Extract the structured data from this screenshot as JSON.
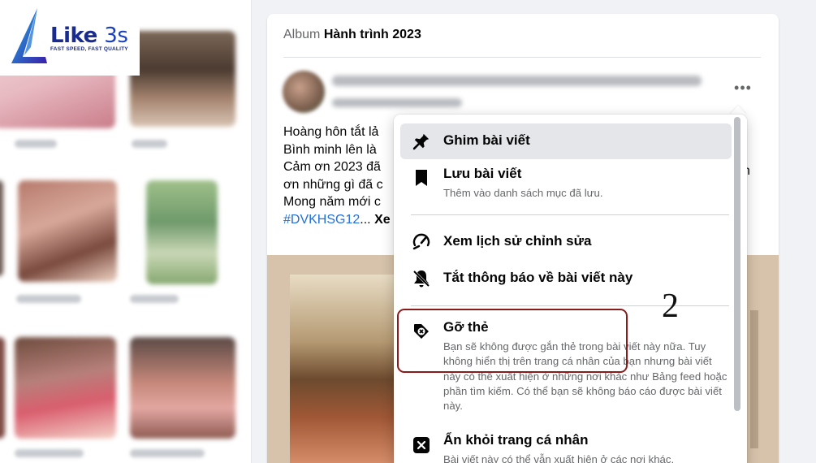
{
  "logo": {
    "brand": "Like",
    "brand_suffix": "3s",
    "tagline": "FAST SPEED, FAST QUALITY"
  },
  "post": {
    "album_prefix": "Album",
    "album_name": "Hành trình 2023",
    "more_icon": "more-horizontal-icon",
    "text_lines": [
      "Hoàng hôn tắt lả",
      "Bình minh lên là",
      "Cảm ơn 2023 đã",
      "ơn những gì đã c",
      "Mong năm mới c"
    ],
    "hashtag": "#DVKHSG12",
    "ellipsis": "...",
    "see_more": "Xe",
    "right_fragment": "n"
  },
  "menu": {
    "items": [
      {
        "icon": "pin-icon",
        "label": "Ghim bài viết"
      },
      {
        "icon": "bookmark-icon",
        "label": "Lưu bài viết",
        "description": "Thêm vào danh sách mục đã lưu."
      },
      {
        "icon": "edit-history-icon",
        "label": "Xem lịch sử chỉnh sửa"
      },
      {
        "icon": "bell-off-icon",
        "label": "Tắt thông báo về bài viết này"
      },
      {
        "icon": "remove-tag-icon",
        "label": "Gỡ thẻ",
        "description": "Bạn sẽ không được gắn thẻ trong bài viết này nữa. Tuy không hiển thị trên trang cá nhân của bạn nhưng bài viết này có thể xuất hiện ở những nơi khác như Bảng feed hoặc phần tìm kiếm. Có thể bạn sẽ không báo cáo được bài viết này."
      },
      {
        "icon": "hide-x-icon",
        "label": "Ẩn khỏi trang cá nhân",
        "description": "Bài viết này có thể vẫn xuất hiện ở các nơi khác."
      }
    ]
  },
  "annotation": {
    "step_number": "2",
    "color": "#8b1a1a"
  },
  "colors": {
    "accent_link": "#216fdb",
    "menu_hover": "#e4e6e9",
    "page_bg": "#f0f2f5"
  }
}
